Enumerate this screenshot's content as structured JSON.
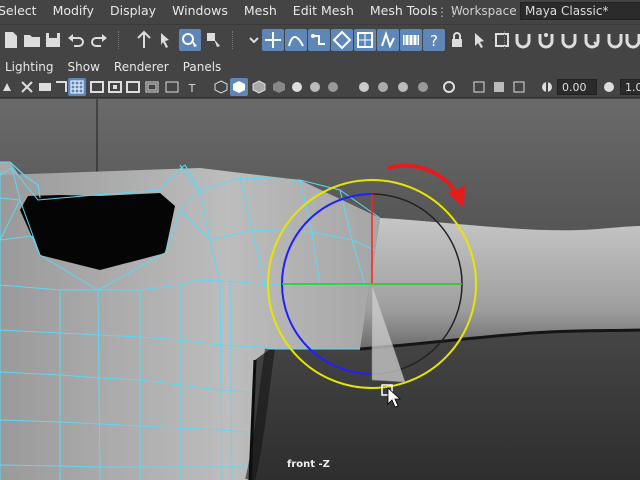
{
  "menubar": {
    "items": [
      "Select",
      "Modify",
      "Display",
      "Windows",
      "Mesh",
      "Edit Mesh",
      "Mesh Tools"
    ],
    "workspace_label": "Workspace :",
    "workspace_value": "Maya Classic*"
  },
  "panel": {
    "menus": [
      "Lighting",
      "Show",
      "Renderer",
      "Panels"
    ],
    "exposure_value": "0.00",
    "gamma_value": "1.0",
    "camera_label": "front -Z"
  },
  "colors": {
    "accent": "#5e87b8",
    "wireframe": "#5fd7f5",
    "rotate_ring_outer": "#e6e600",
    "rotate_axis_x": "#ff2020",
    "rotate_axis_y": "#20d020",
    "rotate_axis_z": "#2020ff",
    "arrow": "#e61c1c"
  },
  "icons": {
    "statusline": [
      "new-scene-icon",
      "open-scene-icon",
      "save-scene-icon",
      "undo-icon",
      "redo-icon",
      "select-tool-icon",
      "lasso-tool-icon",
      "paint-select-icon",
      "snap-grid-icon",
      "snap-curve-icon",
      "snap-point-icon",
      "snap-surface-icon",
      "snap-view-icon",
      "render-icon",
      "help-icon",
      "lock-icon",
      "pick-icon"
    ]
  }
}
